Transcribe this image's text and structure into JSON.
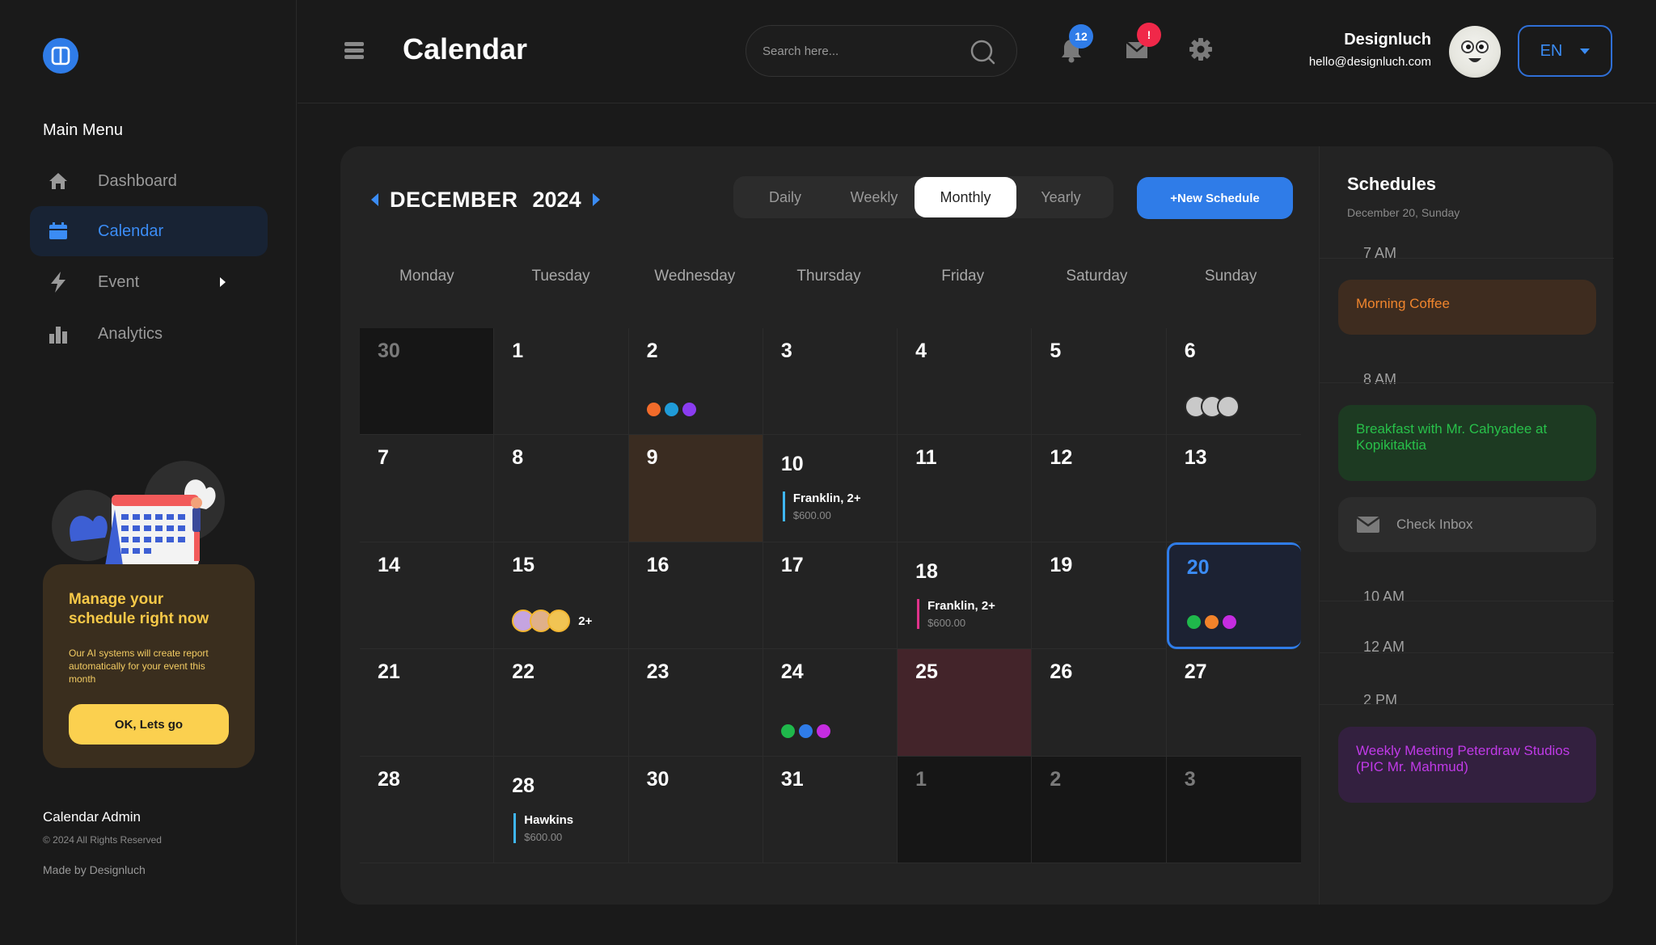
{
  "sidebar": {
    "menu_title": "Main Menu",
    "items": [
      {
        "label": "Dashboard",
        "icon": "home-icon",
        "active": false
      },
      {
        "label": "Calendar",
        "icon": "calendar-icon",
        "active": true
      },
      {
        "label": "Event",
        "icon": "bolt-icon",
        "active": false,
        "has_submenu": true
      },
      {
        "label": "Analytics",
        "icon": "bar-chart-icon",
        "active": false
      }
    ],
    "promo": {
      "title": "Manage your schedule right now",
      "text": "Our AI systems will create report automatically for your event this month",
      "button": "OK, Lets go"
    },
    "footer": {
      "title": "Calendar Admin",
      "copyright": "© 2024 All Rights Reserved",
      "made_by": "Made by Designluch"
    }
  },
  "header": {
    "title": "Calendar",
    "search_placeholder": "Search here...",
    "notifications_count": "12",
    "messages_badge": "!",
    "user_name": "Designluch",
    "user_email": "hello@designluch.com",
    "language": "EN"
  },
  "calendar": {
    "month": "DECEMBER",
    "year": "2024",
    "views": [
      "Daily",
      "Weekly",
      "Monthly",
      "Yearly"
    ],
    "active_view": "Monthly",
    "new_button": "+New Schedule",
    "weekdays": [
      "Monday",
      "Tuesday",
      "Wednesday",
      "Thursday",
      "Friday",
      "Saturday",
      "Sunday"
    ],
    "days": [
      {
        "n": "30",
        "style": "muted"
      },
      {
        "n": "1"
      },
      {
        "n": "2",
        "dots": [
          "#f26b2a",
          "#1f9bd8",
          "#8a3cf0"
        ]
      },
      {
        "n": "3"
      },
      {
        "n": "4"
      },
      {
        "n": "5"
      },
      {
        "n": "6",
        "grey_avatars": 3
      },
      {
        "n": "7"
      },
      {
        "n": "8"
      },
      {
        "n": "9",
        "style": "brown"
      },
      {
        "n": "10",
        "event": {
          "title": "Franklin, 2+",
          "price": "$600.00",
          "color": "#3fb6f2"
        }
      },
      {
        "n": "11"
      },
      {
        "n": "12"
      },
      {
        "n": "13"
      },
      {
        "n": "14"
      },
      {
        "n": "15",
        "avatars": [
          "#c5a4e0",
          "#e0b089",
          "#f1c453"
        ],
        "more": "2+"
      },
      {
        "n": "16"
      },
      {
        "n": "17"
      },
      {
        "n": "18",
        "event": {
          "title": "Franklin, 2+",
          "price": "$600.00",
          "color": "#e0328a"
        }
      },
      {
        "n": "19"
      },
      {
        "n": "20",
        "style": "today",
        "dots": [
          "#1fb84b",
          "#f2832a",
          "#c52ce0"
        ]
      },
      {
        "n": "21"
      },
      {
        "n": "22"
      },
      {
        "n": "23"
      },
      {
        "n": "24",
        "dots": [
          "#1fb84b",
          "#2f7ce8",
          "#c52ce0"
        ]
      },
      {
        "n": "25",
        "style": "maroon"
      },
      {
        "n": "26"
      },
      {
        "n": "27"
      },
      {
        "n": "28"
      },
      {
        "n": "28",
        "event": {
          "title": "Hawkins",
          "price": "$600.00",
          "color": "#3fb6f2"
        }
      },
      {
        "n": "30"
      },
      {
        "n": "31"
      },
      {
        "n": "1",
        "style": "muted"
      },
      {
        "n": "2",
        "style": "muted"
      },
      {
        "n": "3",
        "style": "muted"
      }
    ]
  },
  "schedules": {
    "title": "Schedules",
    "date": "December 20, Sunday",
    "times": [
      "7 AM",
      "8 AM",
      "10 AM",
      "12 AM",
      "2 PM"
    ],
    "items": [
      {
        "label": "Morning Coffee",
        "bg": "#3e2c1f",
        "color": "#f0852d"
      },
      {
        "label": "Breakfast with Mr. Cahyadee at Kopikitaktia",
        "bg": "#1d3a22",
        "color": "#28c04a"
      },
      {
        "label": "Check Inbox",
        "bg": "#2c2c2c",
        "color": "#9a9a9a",
        "icon": "mail-icon"
      },
      {
        "label": "Weekly Meeting Peterdraw Studios (PIC Mr. Mahmud)",
        "bg": "#33203f",
        "color": "#c03ae8"
      }
    ]
  }
}
